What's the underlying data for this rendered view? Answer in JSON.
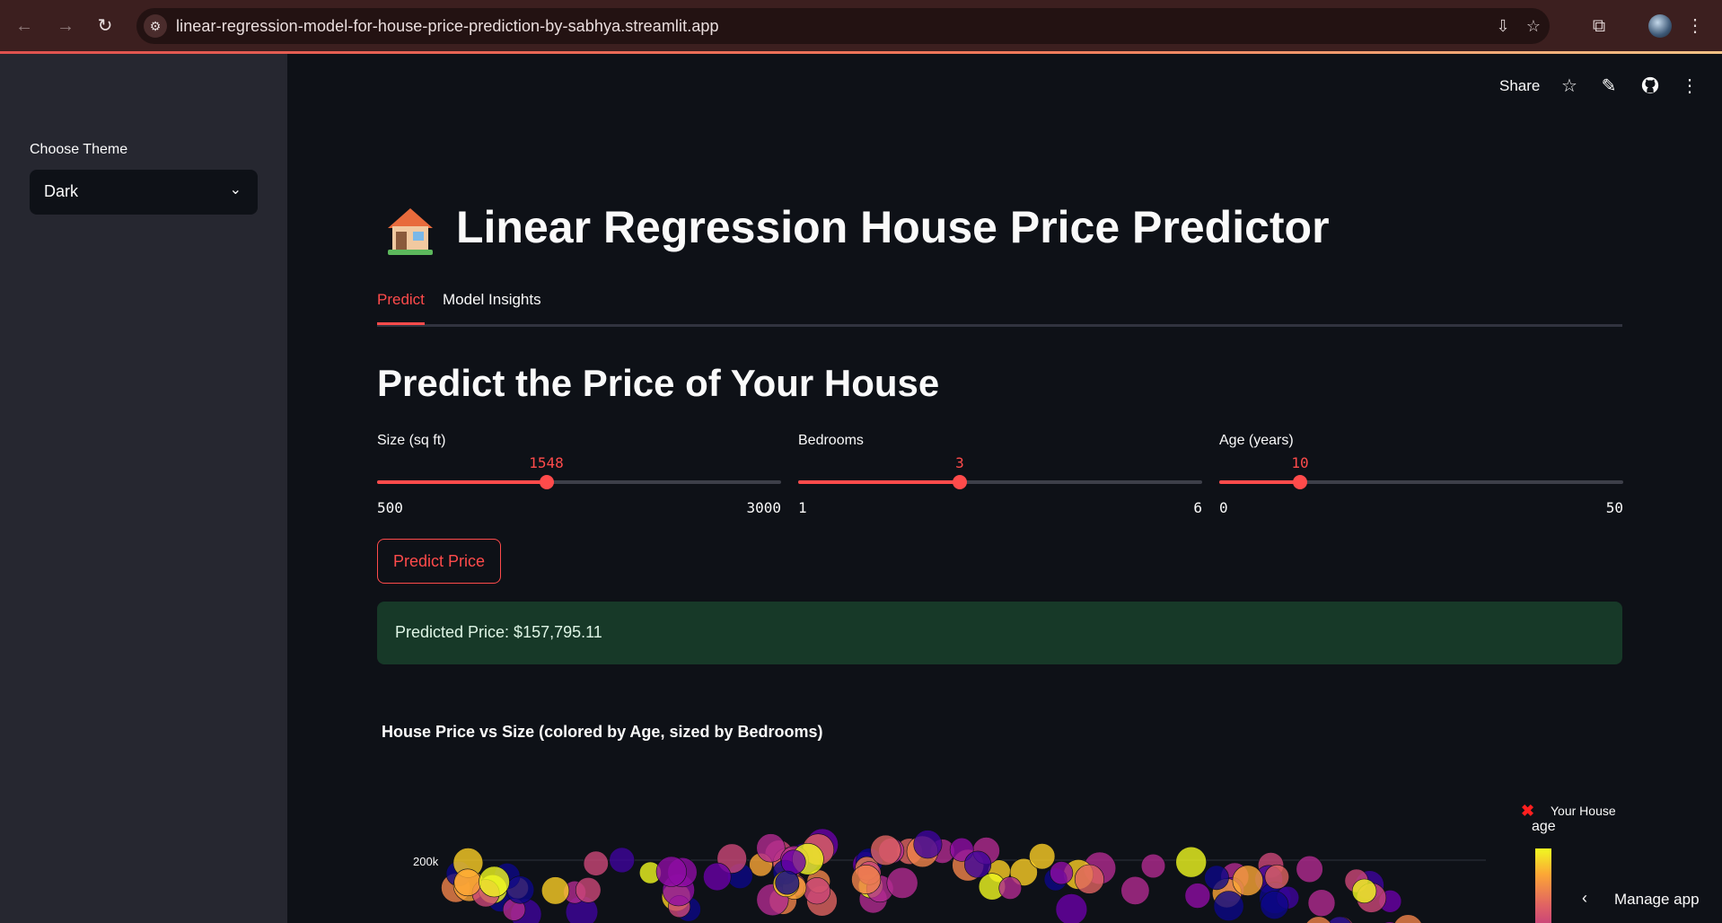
{
  "browser": {
    "url": "linear-regression-model-for-house-price-prediction-by-sabhya.streamlit.app",
    "icons": [
      "back-arrow-icon",
      "forward-arrow-icon",
      "reload-icon",
      "site-settings-icon",
      "install-app-icon",
      "bookmark-star-icon",
      "extensions-icon",
      "profile-avatar",
      "more-vertical-icon"
    ]
  },
  "sidebar": {
    "theme_label": "Choose Theme",
    "theme_value": "Dark"
  },
  "toolbar": {
    "share_label": "Share",
    "icons": [
      "star-icon",
      "edit-pencil-icon",
      "github-icon",
      "more-vertical-icon"
    ]
  },
  "header": {
    "title": "Linear Regression House Price Predictor"
  },
  "tabs": [
    {
      "label": "Predict",
      "active": true
    },
    {
      "label": "Model Insights",
      "active": false
    }
  ],
  "main": {
    "subheading": "Predict the Price of Your House",
    "sliders": [
      {
        "label": "Size (sq ft)",
        "value": "1548",
        "min": "500",
        "max": "3000",
        "fraction": 0.419
      },
      {
        "label": "Bedrooms",
        "value": "3",
        "min": "1",
        "max": "6",
        "fraction": 0.4
      },
      {
        "label": "Age (years)",
        "value": "10",
        "min": "0",
        "max": "50",
        "fraction": 0.2
      }
    ],
    "predict_button": "Predict Price",
    "result_text": "Predicted Price: $157,795.11"
  },
  "chart_data": {
    "type": "scatter",
    "title": "House Price vs Size (colored by Age, sized by Bedrooms)",
    "y_tick_labels": [
      "200k"
    ],
    "legend": {
      "your_house_label": "Your House",
      "marker": "✖"
    },
    "colorbar_title": "age",
    "colors": {
      "low": "#0d0887",
      "mid": "#cc4778",
      "high": "#f0f921"
    }
  },
  "footer": {
    "manage_app": "Manage app"
  }
}
